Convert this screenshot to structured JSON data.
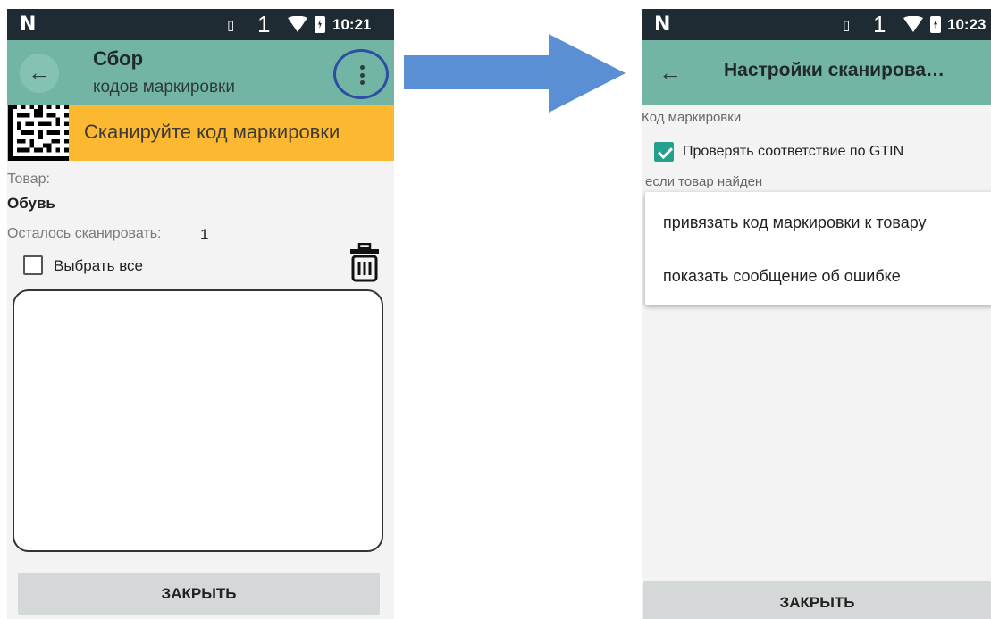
{
  "left_screen": {
    "status_bar": {
      "carrier_icon": "nfc-n-icon",
      "vibrate_icon": "vibrate-icon",
      "sim": "1",
      "wifi_icon": "wifi-icon",
      "battery_icon": "battery-charging-icon",
      "time": "10:21"
    },
    "app_bar": {
      "back_icon": "arrow-back-icon",
      "title": "Сбор",
      "subtitle": "кодов маркировки",
      "menu_icon": "more-vert-icon"
    },
    "scan_banner": {
      "icon": "datamatrix-icon",
      "text": "Сканируйте код маркировки",
      "color": "#fbb830"
    },
    "product_label": "Товар:",
    "product_value": "Обувь",
    "remaining_label": "Осталось сканировать:",
    "remaining_value": "1",
    "select_all_label": "Выбрать все",
    "select_all_checked": false,
    "trash_icon": "trash-icon",
    "close_button": "ЗАКРЫТЬ"
  },
  "right_screen": {
    "status_bar": {
      "carrier_icon": "nfc-n-icon",
      "vibrate_icon": "vibrate-icon",
      "sim": "1",
      "wifi_icon": "wifi-icon",
      "battery_icon": "battery-charging-icon",
      "time": "10:23"
    },
    "app_bar": {
      "back_icon": "arrow-back-icon",
      "title": "Настройки сканирова…"
    },
    "section_label": "Код маркировки",
    "gtin_check_label": "Проверять соответствие по GTIN",
    "gtin_check_checked": true,
    "found_label": "если товар найден",
    "dropdown_options": [
      "привязать код маркировки к товару",
      "показать сообщение об ошибке"
    ],
    "close_button": "ЗАКРЫТЬ"
  },
  "colors": {
    "app_bar": "#72b5a4",
    "status_bar": "#1e2b33",
    "accent_banner": "#fbb830",
    "arrow": "#5b8fd3",
    "checkbox_checked": "#26a08c"
  }
}
